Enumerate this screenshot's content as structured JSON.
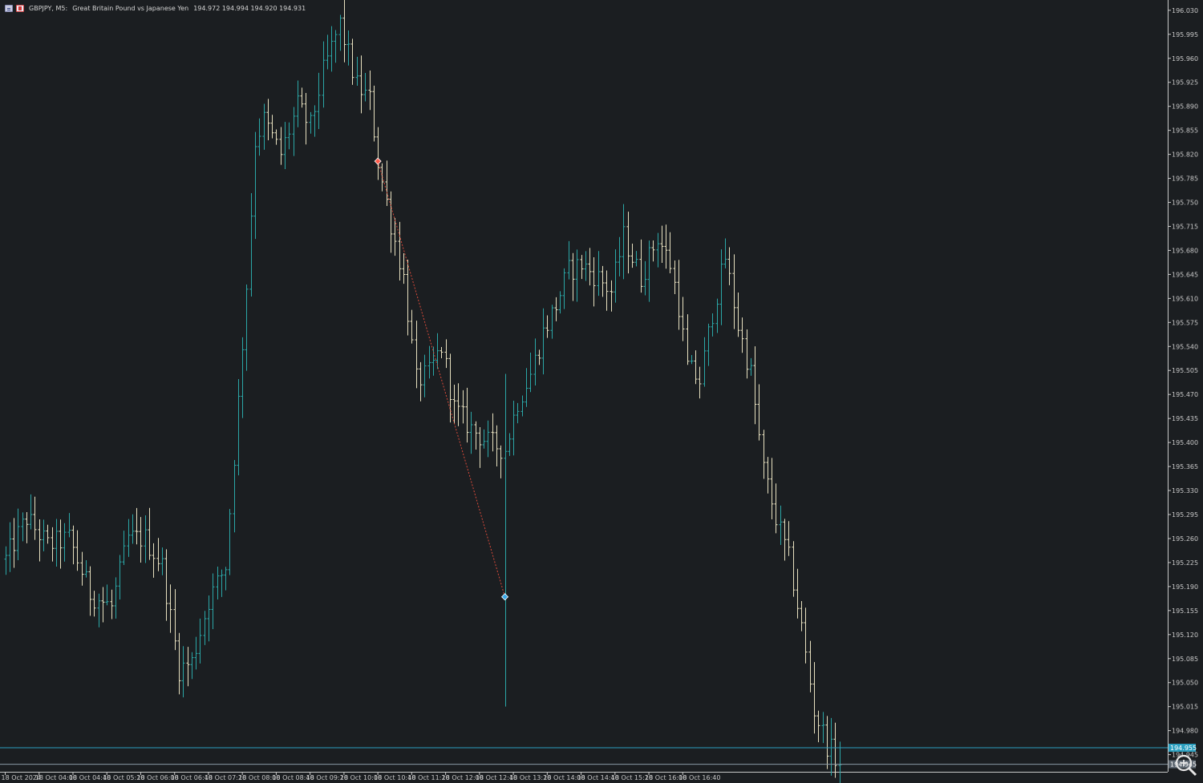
{
  "header": {
    "symbol": "GBPJPY, M5:",
    "description": "Great Britain Pound vs Japanese Yen",
    "ohlc": "194.972 194.994 194.920 194.931"
  },
  "colors": {
    "background": "#1b1e21",
    "bull_bar": "#2ba7a7",
    "bear_bar": "#e8e1c0",
    "bid_line": "#2b9fbf",
    "ask_line": "#8a9aa6",
    "axis_text": "#c8c8c8",
    "frame": "#c8c8c8",
    "trade_line": "#d94a3a",
    "marker_open": "#ff5a4a",
    "marker_close": "#3aa7e8"
  },
  "icons": {
    "menu": "chart-menu-icon",
    "tool": "chart-tool-icon",
    "zoom": "zoom-magnifier-icon"
  },
  "price_labels": {
    "current": "194.955",
    "ask": "194.945"
  },
  "chart_data": {
    "type": "ohlc",
    "title": "GBPJPY, M5:",
    "ylim": [
      194.92,
      196.045
    ],
    "y_ticks": [
      "196.030",
      "195.995",
      "195.960",
      "195.925",
      "195.890",
      "195.855",
      "195.820",
      "195.785",
      "195.750",
      "195.715",
      "195.680",
      "195.645",
      "195.610",
      "195.575",
      "195.540",
      "195.505",
      "195.470",
      "195.435",
      "195.400",
      "195.365",
      "195.330",
      "195.295",
      "195.260",
      "195.225",
      "195.190",
      "195.155",
      "195.120",
      "195.085",
      "195.050",
      "195.015",
      "194.980",
      "194.945"
    ],
    "x_tick_labels": [
      "18 Oct 2024",
      "18 Oct 04:00",
      "18 Oct 04:40",
      "18 Oct 05:20",
      "18 Oct 06:00",
      "18 Oct 06:40",
      "18 Oct 07:20",
      "18 Oct 08:00",
      "18 Oct 08:40",
      "18 Oct 09:20",
      "18 Oct 10:00",
      "18 Oct 10:40",
      "18 Oct 11:20",
      "18 Oct 12:00",
      "18 Oct 12:40",
      "18 Oct 13:20",
      "18 Oct 14:00",
      "18 Oct 14:40",
      "18 Oct 15:20",
      "18 Oct 16:00",
      "18 Oct 16:40"
    ],
    "bar_count": 198,
    "bars_per_x_tick": 8,
    "bid_price": 194.955,
    "ask_price": 194.931,
    "trade": {
      "open_bar": 88,
      "open_price": 195.81,
      "close_bar": 118,
      "close_price": 195.175
    },
    "keypoints": [
      [
        0,
        195.23
      ],
      [
        5,
        195.29
      ],
      [
        10,
        195.25
      ],
      [
        15,
        195.26
      ],
      [
        20,
        195.18
      ],
      [
        25,
        195.16
      ],
      [
        29,
        195.26
      ],
      [
        33,
        195.26
      ],
      [
        37,
        195.22
      ],
      [
        41,
        195.07
      ],
      [
        44,
        195.08
      ],
      [
        48,
        195.17
      ],
      [
        52,
        195.22
      ],
      [
        55,
        195.46
      ],
      [
        57,
        195.63
      ],
      [
        59,
        195.84
      ],
      [
        61,
        195.87
      ],
      [
        65,
        195.82
      ],
      [
        69,
        195.89
      ],
      [
        72,
        195.86
      ],
      [
        75,
        195.94
      ],
      [
        79,
        196.01
      ],
      [
        83,
        195.92
      ],
      [
        86,
        195.9
      ],
      [
        88,
        195.81
      ],
      [
        91,
        195.72
      ],
      [
        94,
        195.64
      ],
      [
        97,
        195.49
      ],
      [
        100,
        195.5
      ],
      [
        103,
        195.54
      ],
      [
        106,
        195.45
      ],
      [
        110,
        195.42
      ],
      [
        114,
        195.4
      ],
      [
        118,
        195.39
      ],
      [
        121,
        195.46
      ],
      [
        124,
        195.5
      ],
      [
        127,
        195.56
      ],
      [
        130,
        195.6
      ],
      [
        133,
        195.65
      ],
      [
        136,
        195.66
      ],
      [
        140,
        195.64
      ],
      [
        143,
        195.62
      ],
      [
        146,
        195.7
      ],
      [
        150,
        195.64
      ],
      [
        154,
        195.7
      ],
      [
        157,
        195.66
      ],
      [
        159,
        195.6
      ],
      [
        161,
        195.51
      ],
      [
        164,
        195.49
      ],
      [
        167,
        195.59
      ],
      [
        170,
        195.67
      ],
      [
        173,
        195.57
      ],
      [
        176,
        195.5
      ],
      [
        179,
        195.36
      ],
      [
        182,
        195.29
      ],
      [
        185,
        195.23
      ],
      [
        188,
        195.13
      ],
      [
        191,
        195.01
      ],
      [
        194,
        194.96
      ],
      [
        197,
        194.931
      ]
    ]
  }
}
